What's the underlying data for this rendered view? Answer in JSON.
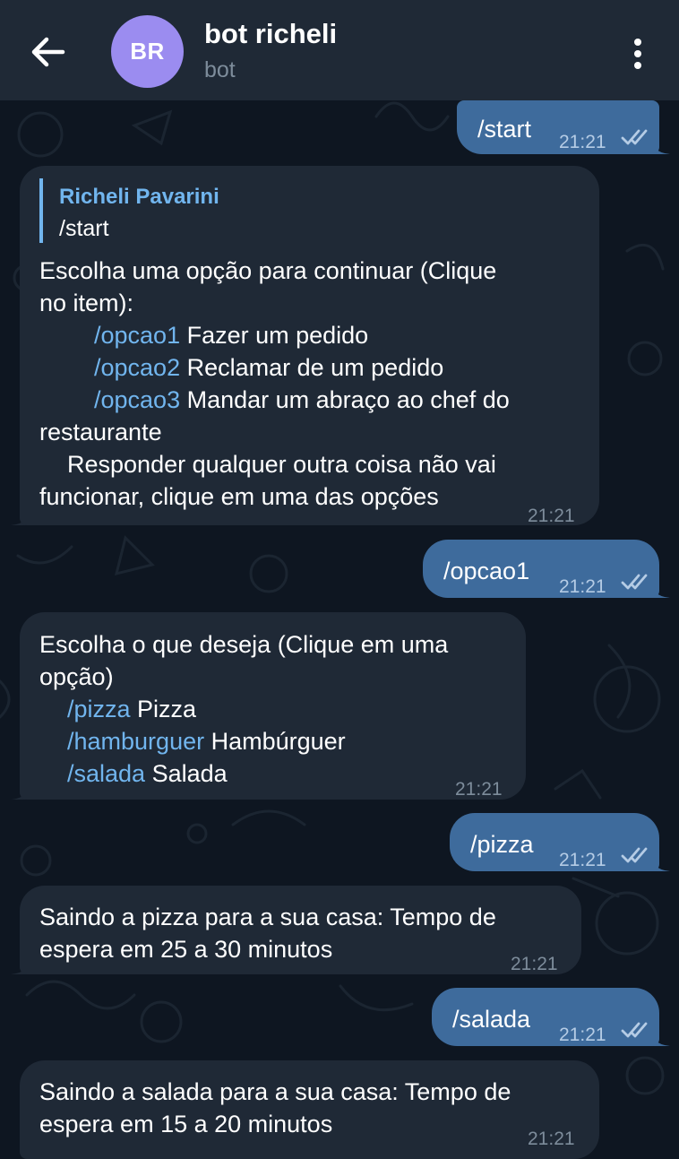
{
  "header": {
    "avatar_initials": "BR",
    "avatar_color": "#9b8cf0",
    "title": "bot richeli",
    "status": "bot"
  },
  "colors": {
    "background": "#0e1621",
    "header": "#1f2936",
    "incoming_bubble": "#1f2936",
    "outgoing_bubble": "#3e6b9c",
    "command_link": "#71b5ee"
  },
  "icons": [
    "arrow-left-icon",
    "more-vertical-icon",
    "double-check-icon"
  ],
  "messages": {
    "m1": {
      "text": "/start",
      "time": "21:21"
    },
    "m2": {
      "reply_name": "Richeli Pavarini",
      "reply_text": "/start",
      "l1": "Escolha uma opção para continuar (Clique",
      "l2": "no item):",
      "l3_cmd": "/opcao1",
      "l3_text": " Fazer um pedido",
      "l4_cmd": "/opcao2",
      "l4_text": " Reclamar de um pedido",
      "l5_cmd": "/opcao3",
      "l5_text": " Mandar um abraço ao chef do",
      "l6": "restaurante",
      "l7": "Responder qualquer outra coisa não vai",
      "l8": "funcionar, clique em uma das opções",
      "time": "21:21"
    },
    "m3": {
      "text": "/opcao1",
      "time": "21:21"
    },
    "m4": {
      "l1": "Escolha o que deseja (Clique em uma",
      "l2": "opção)",
      "l3_cmd": "/pizza",
      "l3_text": " Pizza",
      "l4_cmd": "/hamburguer",
      "l4_text": " Hambúrguer",
      "l5_cmd": "/salada",
      "l5_text": " Salada",
      "time": "21:21"
    },
    "m5": {
      "text": "/pizza",
      "time": "21:21"
    },
    "m6": {
      "l1": "Saindo a pizza para a sua casa: Tempo de",
      "l2": "espera em 25 a 30 minutos",
      "time": "21:21"
    },
    "m7": {
      "text": "/salada",
      "time": "21:21"
    },
    "m8": {
      "l1": "Saindo a salada para a sua casa: Tempo de",
      "l2": "espera em 15 a 20 minutos",
      "time": "21:21"
    }
  }
}
